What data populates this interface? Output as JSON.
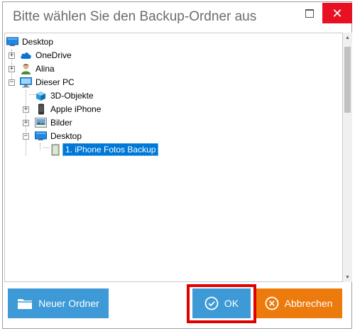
{
  "dialog": {
    "title": "Bitte wählen Sie den Backup-Ordner aus",
    "close_glyph": "✕"
  },
  "tree": {
    "root": {
      "label": "Desktop",
      "icon": "desktop-folder-icon"
    },
    "onedrive": {
      "label": "OneDrive",
      "icon": "cloud-icon"
    },
    "alina": {
      "label": "Alina",
      "icon": "user-icon"
    },
    "dieser_pc": {
      "label": "Dieser PC",
      "icon": "computer-icon"
    },
    "objects3d": {
      "label": "3D-Objekte",
      "icon": "cube-icon"
    },
    "apple_iphone": {
      "label": "Apple iPhone",
      "icon": "phone-icon"
    },
    "bilder": {
      "label": "Bilder",
      "icon": "pictures-icon"
    },
    "desktop_sub": {
      "label": "Desktop",
      "icon": "desktop-folder-icon"
    },
    "iphone_backup": {
      "label": "1. iPhone Fotos Backup",
      "icon": "folder-icon",
      "selected": true
    }
  },
  "expanders": {
    "plus": "+",
    "minus": "−"
  },
  "buttons": {
    "new_folder": "Neuer Ordner",
    "ok": "OK",
    "cancel": "Abbrechen"
  },
  "colors": {
    "button_blue": "#3d9ad6",
    "button_orange": "#ec7a0c",
    "close_red": "#e81123",
    "selection_blue": "#0078d7",
    "highlight_red": "#e00000"
  }
}
